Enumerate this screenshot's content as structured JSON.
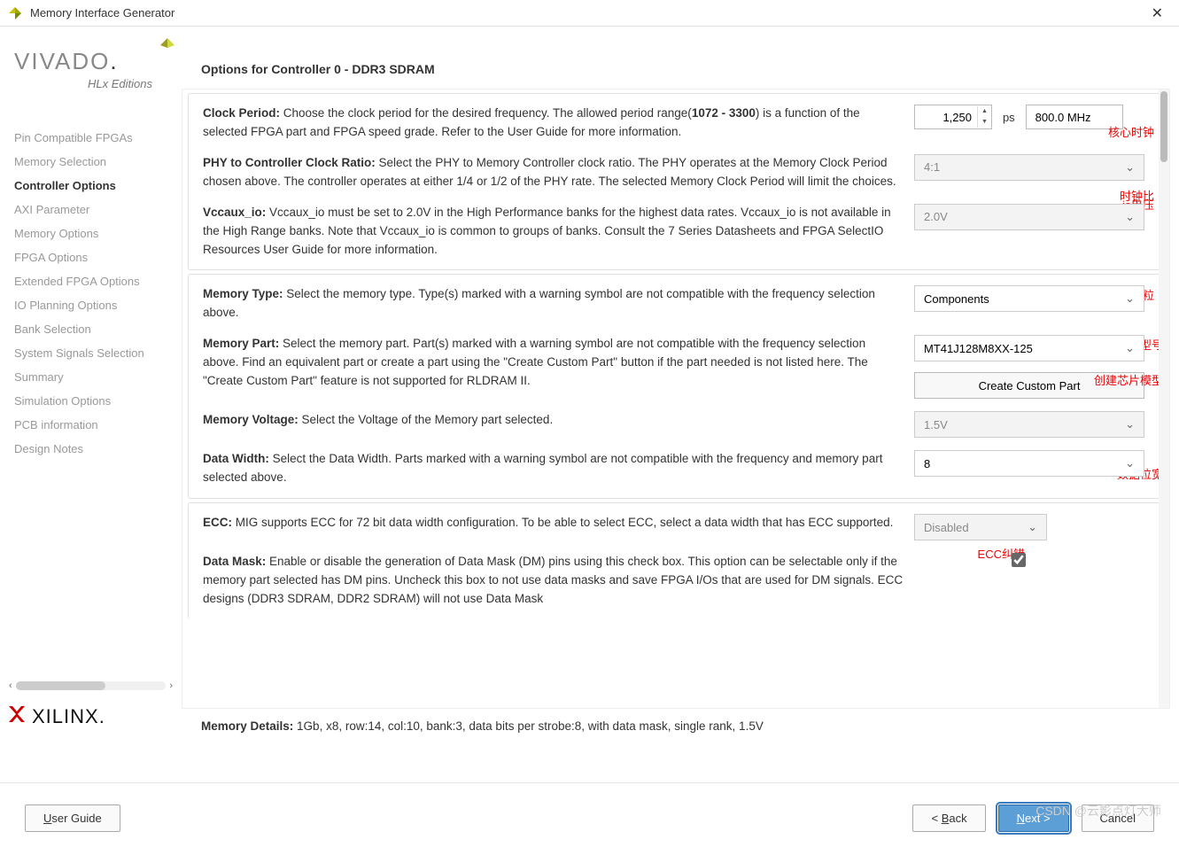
{
  "window": {
    "title": "Memory Interface Generator"
  },
  "logo": {
    "vivado": "VIVADO",
    "hlx": "HLx Editions",
    "xilinx": "XILINX"
  },
  "nav": [
    "Pin Compatible FPGAs",
    "Memory Selection",
    "Controller Options",
    "AXI Parameter",
    "Memory Options",
    "FPGA Options",
    "Extended FPGA Options",
    "IO Planning Options",
    "Bank Selection",
    "System Signals Selection",
    "Summary",
    "Simulation Options",
    "PCB information",
    "Design Notes"
  ],
  "nav_active_index": 2,
  "page_title": "Options for Controller 0 - DDR3 SDRAM",
  "opts": {
    "clock_period": {
      "label": "Clock Period:",
      "text_pre": " Choose the clock period for the desired frequency. The allowed period range(",
      "range": "1072 - 3300",
      "text_post": ") is a function of the selected FPGA part and FPGA speed grade. Refer to the User Guide for more information.",
      "value": "1,250",
      "unit": "ps",
      "mhz": "800.0 MHz",
      "note": "核心时钟"
    },
    "phy_ratio": {
      "label": "PHY to Controller Clock Ratio:",
      "text": " Select the PHY to Memory Controller clock ratio. The PHY operates at the Memory Clock Period chosen above. The controller operates at either 1/4 or 1/2 of the PHY rate. The selected Memory Clock Period will limit the choices.",
      "value": "4:1",
      "note": "时钟比"
    },
    "vccaux": {
      "label": "Vccaux_io:",
      "text": " Vccaux_io must be set to 2.0V in the High Performance banks for the highest data rates. Vccaux_io is not available in the High Range banks. Note that Vccaux_io is common to groups of banks. Consult the 7 Series Datasheets and FPGA SelectIO Resources User Guide for more information.",
      "value": "2.0V",
      "note": "io电压"
    },
    "mem_type": {
      "label": "Memory Type:",
      "text": " Select the memory type. Type(s) marked with a warning symbol are not compatible with the frequency selection above.",
      "value": "Components",
      "note": "颗粒"
    },
    "mem_part": {
      "label": "Memory Part:",
      "text": " Select the memory part. Part(s) marked with a warning symbol are not compatible with the frequency selection above. Find an equivalent part or create a part using the \"Create Custom Part\" button if the part needed is not listed here. The \"Create Custom Part\" feature is not supported for RLDRAM II.",
      "value": "MT41J128M8XX-125",
      "button": "Create Custom Part",
      "note1": "芯片型号",
      "note2": "创建芯片模型"
    },
    "mem_voltage": {
      "label": "Memory Voltage:",
      "text": " Select the Voltage of the Memory part selected.",
      "value": "1.5V"
    },
    "data_width": {
      "label": "Data Width:",
      "text": " Select the Data Width. Parts marked with a warning symbol are not compatible with the frequency and memory part selected above.",
      "value": "8",
      "note": "数据位宽"
    },
    "ecc": {
      "label": "ECC:",
      "text": " MIG supports ECC for 72 bit data width configuration. To be able to select ECC, select a data width that has ECC supported.",
      "value": "Disabled",
      "note": "ECC纠错"
    },
    "data_mask": {
      "label": "Data Mask:",
      "text": " Enable or disable the generation of Data Mask (DM) pins using this check box. This option can be selectable only if the memory part selected has DM pins. Uncheck this box to not use data masks and save FPGA I/Os that are used for DM signals. ECC designs (DDR3 SDRAM, DDR2 SDRAM) will not use Data Mask",
      "checked": true
    }
  },
  "memory_details": {
    "label": "Memory Details:",
    "text": " 1Gb, x8, row:14, col:10, bank:3, data bits per strobe:8, with data mask, single rank, 1.5V"
  },
  "footer": {
    "user_guide": "User Guide",
    "back": "< Back",
    "next": "Next >",
    "cancel": "Cancel"
  },
  "watermark": "CSDN @云影点灯大师"
}
